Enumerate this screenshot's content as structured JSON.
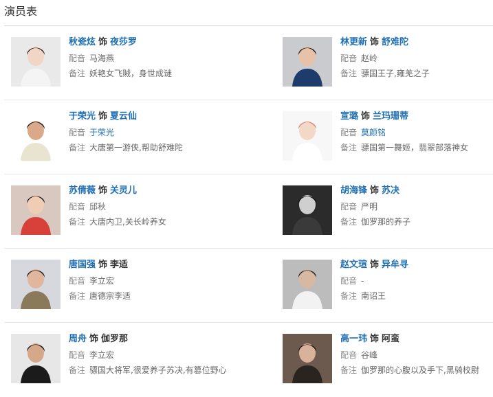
{
  "page_title": "演员表",
  "label_as": "饰",
  "label_dub": "配音",
  "label_note": "备注",
  "cast": [
    {
      "actor": "秋瓷炫",
      "role": "夜莎罗",
      "role_link": true,
      "dub": "马海燕",
      "dub_link": false,
      "note": "妖艳女飞贼，身世成谜",
      "bg": "#e9e9ea",
      "skin": "#f1d6c6",
      "hair": "#3a2a22",
      "cloth": "#f4f4f4"
    },
    {
      "actor": "林更新",
      "role": "舒难陀",
      "role_link": true,
      "dub": "赵岭",
      "dub_link": false,
      "note": "骠国王子,雍羌之子",
      "bg": "#c9cbcf",
      "skin": "#e8c2a8",
      "hair": "#1a1714",
      "cloth": "#1d3b6b"
    },
    {
      "actor": "于荣光",
      "role": "夏云仙",
      "role_link": true,
      "dub": "于荣光",
      "dub_link": true,
      "note": "大唐第一游侠,帮助舒难陀",
      "bg": "#ffffff",
      "skin": "#d9a98a",
      "hair": "#1a1a1a",
      "cloth": "#e8e4cf"
    },
    {
      "actor": "宣璐",
      "role": "兰玛珊蒂",
      "role_link": true,
      "dub": "莫颜铭",
      "dub_link": true,
      "note": "骠国第一舞姬，翡翠部落神女",
      "bg": "#f7f7f8",
      "skin": "#f3d8c8",
      "hair": "#d9826a",
      "cloth": "#ffffff"
    },
    {
      "actor": "苏倩薇",
      "role": "关灵儿",
      "role_link": true,
      "dub": "邱秋",
      "dub_link": false,
      "note": "大唐内卫,关长岭养女",
      "bg": "#d8c8c0",
      "skin": "#efcdb5",
      "hair": "#231a17",
      "cloth": "#d8403a"
    },
    {
      "actor": "胡海锋",
      "role": "苏决",
      "role_link": true,
      "dub": "严明",
      "dub_link": false,
      "note": "伽罗那的养子",
      "bg": "#2b2b2b",
      "skin": "#cfcfcf",
      "hair": "#0e0e0e",
      "cloth": "#3a3a3a"
    },
    {
      "actor": "唐国强",
      "role": "李适",
      "role_link": false,
      "dub": "李立宏",
      "dub_link": false,
      "note": "唐德宗李适",
      "bg": "#d6d8de",
      "skin": "#e0b79c",
      "hair": "#151515",
      "cloth": "#8a7a5a"
    },
    {
      "actor": "赵文瑄",
      "role": "异牟寻",
      "role_link": true,
      "dub": "-",
      "dub_link": false,
      "note": "南诏王",
      "bg": "#bcbcbc",
      "skin": "#d7b9a2",
      "hair": "#1b1b1b",
      "cloth": "#f2f2f2"
    },
    {
      "actor": "周舟",
      "role": "伽罗那",
      "role_link": false,
      "dub": "李立宏",
      "dub_link": false,
      "note": "骠国大将军,很爱养子苏决,有篡位野心",
      "bg": "#e7e7e7",
      "skin": "#d6a88a",
      "hair": "#141414",
      "cloth": "#1b1b1b"
    },
    {
      "actor": "高一玮",
      "role": "阿蛮",
      "role_link": false,
      "dub": "谷峰",
      "dub_link": false,
      "note": "伽罗那的心腹以及手下,黑骑校尉",
      "bg": "#6b5a4d",
      "skin": "#d8b29a",
      "hair": "#1a1410",
      "cloth": "#2a2420"
    }
  ]
}
